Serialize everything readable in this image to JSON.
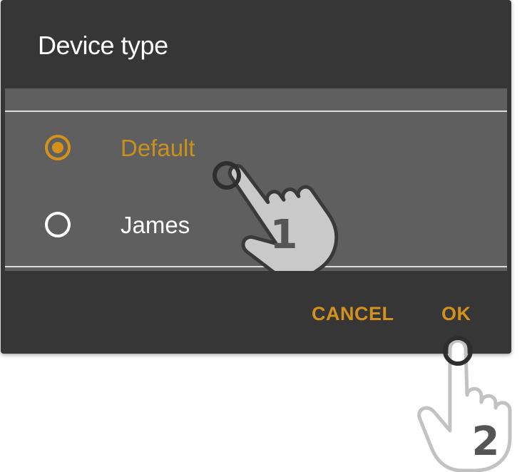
{
  "dialog": {
    "title": "Device type",
    "options": [
      {
        "label": "Default",
        "selected": true
      },
      {
        "label": "James",
        "selected": false
      }
    ],
    "actions": {
      "cancel_label": "CANCEL",
      "ok_label": "OK"
    }
  },
  "step_markers": [
    {
      "number": "1",
      "icon": "tap-hand-icon"
    },
    {
      "number": "2",
      "icon": "tap-hand-icon"
    }
  ],
  "colors": {
    "dialog_bg": "#363636",
    "list_bg": "#5f5f5f",
    "accent": "#d3921c",
    "text": "#ffffff",
    "hand_fill": "#c9c9c9"
  }
}
